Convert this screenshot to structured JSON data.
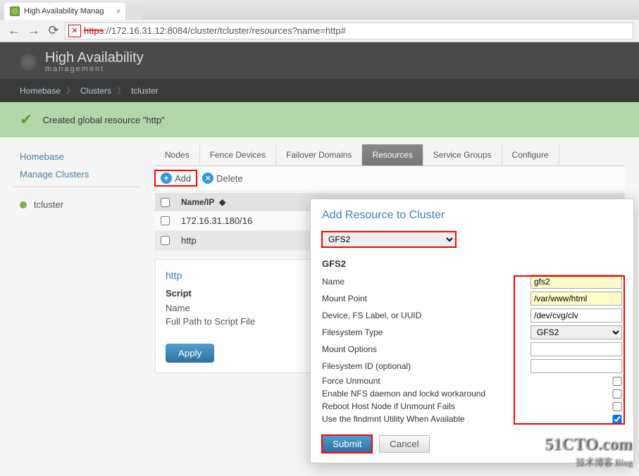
{
  "browser": {
    "tab_title": "High Availability Manag",
    "url_strike": "https",
    "url_rest": "://172.16.31.12:8084/cluster/tcluster/resources?name=http#"
  },
  "header": {
    "title": "High Availability",
    "subtitle": "management"
  },
  "breadcrumb": {
    "home": "Homebase",
    "mid": "Clusters",
    "leaf": "tcluster"
  },
  "flash": "Created global resource \"http\"",
  "sidebar": {
    "home": "Homebase",
    "manage": "Manage Clusters",
    "cluster": "tcluster"
  },
  "tabs": [
    "Nodes",
    "Fence Devices",
    "Failover Domains",
    "Resources",
    "Service Groups",
    "Configure"
  ],
  "active_tab_index": 3,
  "actions": {
    "add": "Add",
    "delete": "Delete"
  },
  "table": {
    "header": "Name/IP",
    "sort": "◆",
    "rows": [
      "172.16.31.180/16",
      "http"
    ]
  },
  "panel": {
    "title": "http",
    "section": "Script",
    "row1": "Name",
    "row2": "Full Path to Script File",
    "apply": "Apply"
  },
  "dialog": {
    "title": "Add Resource to Cluster",
    "type_value": "GFS2",
    "subtitle": "GFS2",
    "labels": {
      "name": "Name",
      "mount_point": "Mount Point",
      "device": "Device, FS Label, or UUID",
      "fstype": "Filesystem Type",
      "mount_opts": "Mount Options",
      "fsid": "Filesystem ID (optional)",
      "force": "Force Unmount",
      "nfs": "Enable NFS daemon and lockd workaround",
      "reboot": "Reboot Host Node if Unmount Fails",
      "findmnt": "Use the findmnt Utility When Available"
    },
    "values": {
      "name": "gfs2",
      "mount_point": "/var/www/html",
      "device": "/dev/cvg/clv",
      "fstype": "GFS2",
      "mount_opts": "",
      "fsid": ""
    },
    "submit": "Submit",
    "cancel": "Cancel"
  },
  "watermark": {
    "main": "51CTO.com",
    "sub": "技术博客  Blog"
  }
}
